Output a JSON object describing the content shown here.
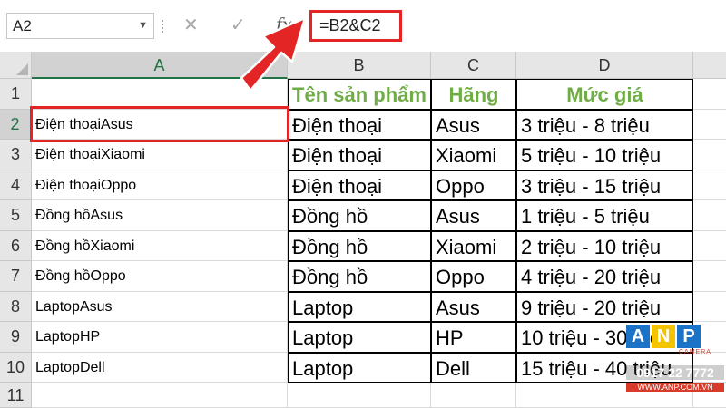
{
  "formula_bar": {
    "name_box": "A2",
    "formula": "=B2&C2",
    "cancel_glyph": "✕",
    "enter_glyph": "✓",
    "fx_label": "fx"
  },
  "columns": [
    "A",
    "B",
    "C",
    "D"
  ],
  "rows": [
    "1",
    "2",
    "3",
    "4",
    "5",
    "6",
    "7",
    "8",
    "9",
    "10",
    "11"
  ],
  "header_row": {
    "b": "Tên sản phẩm",
    "c": "Hãng",
    "d": "Mức giá"
  },
  "data_rows": [
    {
      "a": "Điện thoạiAsus",
      "b": "Điện thoại",
      "c": "Asus",
      "d": "3 triệu - 8 triệu"
    },
    {
      "a": "Điện thoạiXiaomi",
      "b": "Điện thoại",
      "c": "Xiaomi",
      "d": "5 triệu - 10 triệu"
    },
    {
      "a": "Điện thoạiOppo",
      "b": "Điện thoại",
      "c": "Oppo",
      "d": "3 triệu - 15 triệu"
    },
    {
      "a": "Đồng hồAsus",
      "b": "Đồng hồ",
      "c": "Asus",
      "d": "1 triệu - 5 triệu"
    },
    {
      "a": "Đồng hồXiaomi",
      "b": "Đồng hồ",
      "c": "Xiaomi",
      "d": "2 triệu - 10 triệu"
    },
    {
      "a": "Đồng hồOppo",
      "b": "Đồng hồ",
      "c": "Oppo",
      "d": "4 triệu - 20 triệu"
    },
    {
      "a": "LaptopAsus",
      "b": "Laptop",
      "c": "Asus",
      "d": "9 triệu - 20 triệu"
    },
    {
      "a": "LaptopHP",
      "b": "Laptop",
      "c": "HP",
      "d": "10 triệu - 30 triệu"
    },
    {
      "a": "LaptopDell",
      "b": "Laptop",
      "c": "Dell",
      "d": "15 triệu - 40 triệu"
    }
  ],
  "colors": {
    "header_text": "#70ad47",
    "highlight": "#e32525",
    "selection": "#217346"
  },
  "watermark": {
    "letters": [
      "A",
      "N",
      "P"
    ],
    "brand": "CAMERA",
    "phone": "0917 22 7772",
    "url": "WWW.ANP.COM.VN"
  }
}
